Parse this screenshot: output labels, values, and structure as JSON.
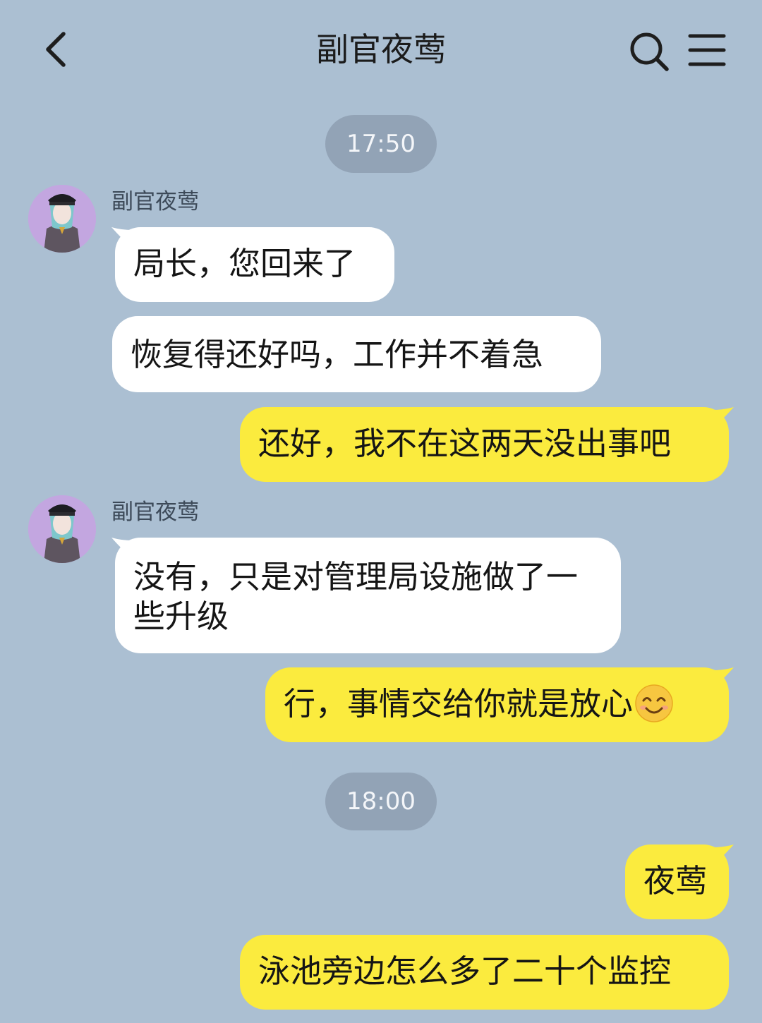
{
  "header": {
    "title": "副官夜莺",
    "back_icon": "chevron-left-icon",
    "search_icon": "search-icon",
    "menu_icon": "hamburger-menu-icon"
  },
  "colors": {
    "background": "#abbfd2",
    "incoming_bubble": "#ffffff",
    "outgoing_bubble": "#fbeb3e",
    "time_pill": "#92a3b6",
    "avatar_bg": "#c3a6e0"
  },
  "timestamps": [
    "17:50",
    "18:00"
  ],
  "groups": [
    {
      "sender": "副官夜莺",
      "avatar_icon": "officer-avatar-icon",
      "messages": [
        "局长，您回来了",
        "恢复得还好吗，工作并不着急"
      ]
    },
    {
      "sender": "副官夜莺",
      "avatar_icon": "officer-avatar-icon",
      "messages": [
        "没有，只是对管理局设施做了一些升级"
      ]
    }
  ],
  "outgoing": [
    "还好，我不在这两天没出事吧",
    "行，事情交给你就是放心",
    "夜莺",
    "泳池旁边怎么多了二十个监控"
  ],
  "outgoing_emoji": "smiling-face-emoji"
}
